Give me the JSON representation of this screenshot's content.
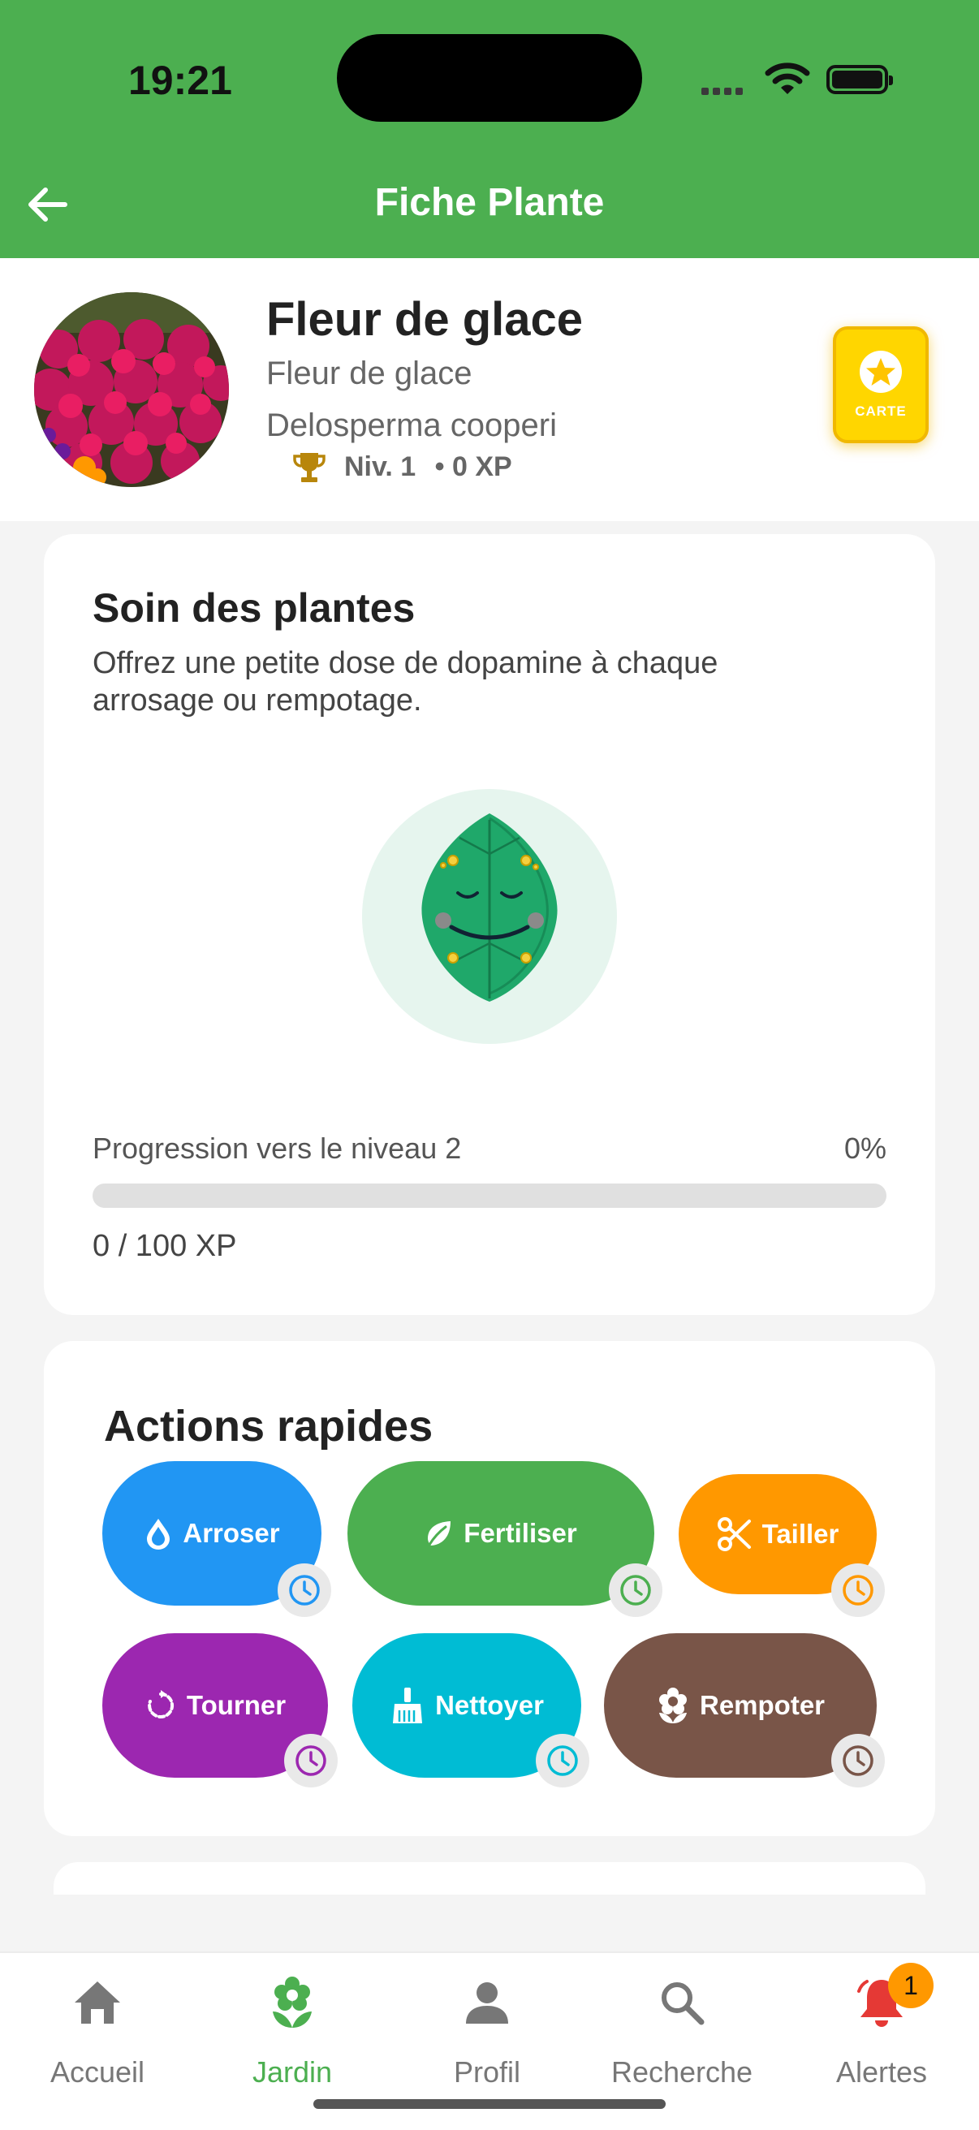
{
  "status_bar": {
    "time": "19:21"
  },
  "header": {
    "title": "Fiche Plante",
    "back_icon": "arrow-left-icon",
    "color": "#4caf50"
  },
  "plant": {
    "name": "Fleur de glace",
    "common_name": "Fleur de glace",
    "scientific_name": "Delosperma cooperi",
    "level": "Niv. 1",
    "xp": "• 0 XP",
    "card_button": {
      "label": "CARTE",
      "icon": "star-icon",
      "color": "#ffd600"
    }
  },
  "care": {
    "title": "Soin des plantes",
    "description": "Offrez une petite dose de dopamine à chaque arrosage ou rempotage.",
    "progress_label": "Progression vers le niveau 2",
    "progress_percent": "0%",
    "progress_value": 0,
    "xp_text": "0 / 100 XP"
  },
  "actions": {
    "title": "Actions rapides",
    "items": [
      {
        "label": "Arroser",
        "icon": "water-drop-icon",
        "color": "#2196f3"
      },
      {
        "label": "Fertiliser",
        "icon": "leaf-icon",
        "color": "#4caf50"
      },
      {
        "label": "Tailler",
        "icon": "scissors-icon",
        "color": "#ff9800"
      },
      {
        "label": "Tourner",
        "icon": "rotate-icon",
        "color": "#9c27b0"
      },
      {
        "label": "Nettoyer",
        "icon": "broom-icon",
        "color": "#00bcd4"
      },
      {
        "label": "Rempoter",
        "icon": "flower-icon",
        "color": "#795548"
      }
    ]
  },
  "nav": {
    "items": [
      {
        "label": "Accueil",
        "icon": "home-icon"
      },
      {
        "label": "Jardin",
        "icon": "flower-icon",
        "active": true
      },
      {
        "label": "Profil",
        "icon": "person-icon"
      },
      {
        "label": "Recherche",
        "icon": "search-icon"
      },
      {
        "label": "Alertes",
        "icon": "bell-icon"
      }
    ],
    "alerts_badge": "1"
  }
}
